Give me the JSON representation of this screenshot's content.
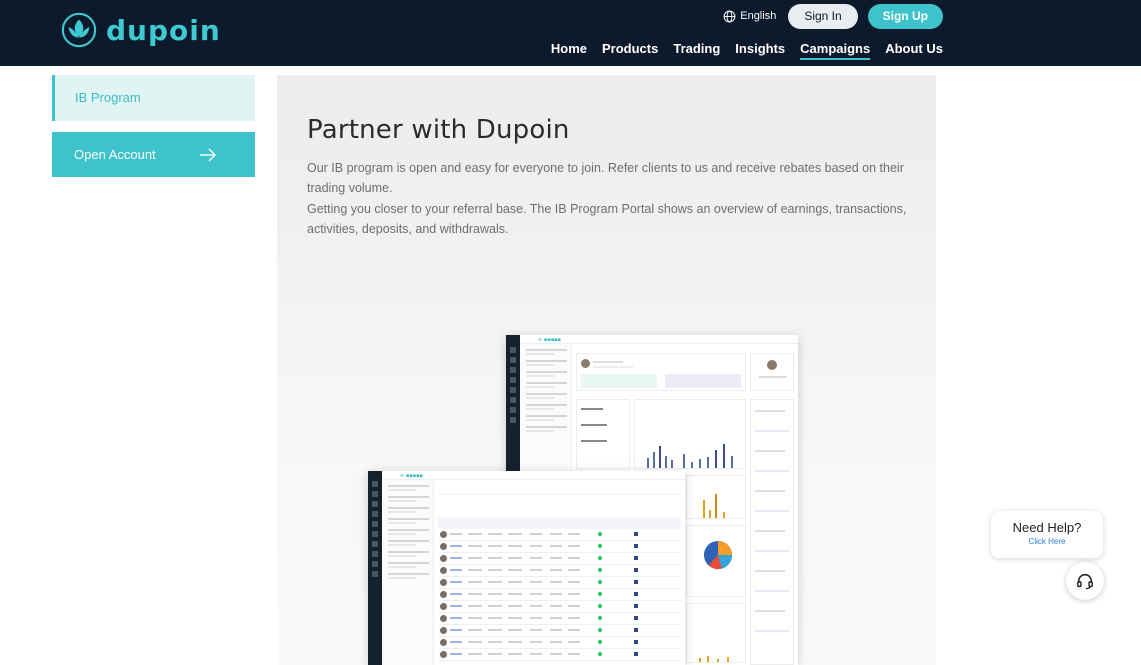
{
  "header": {
    "logo_text": "dupoin",
    "language": "English",
    "sign_in": "Sign In",
    "sign_up": "Sign Up",
    "nav": [
      {
        "label": "Home",
        "active": false
      },
      {
        "label": "Products",
        "active": false
      },
      {
        "label": "Trading",
        "active": false
      },
      {
        "label": "Insights",
        "active": false
      },
      {
        "label": "Campaigns",
        "active": true
      },
      {
        "label": "About Us",
        "active": false
      }
    ]
  },
  "sidebar": {
    "ib_program": "IB Program",
    "open_account": "Open Account"
  },
  "main": {
    "title": "Partner with Dupoin",
    "paragraph1": "Our IB program is open and easy for everyone to join. Refer clients to us and receive rebates based on their trading volume.",
    "paragraph2": "Getting you closer to your referral base. The IB Program Portal shows an overview of earnings, transactions, activities, deposits, and withdrawals."
  },
  "help": {
    "title": "Need Help?",
    "link": "Click Here"
  },
  "colors": {
    "header_bg": "#0c1a2c",
    "accent": "#3ec3cc",
    "sidebar_active_bg": "#e0f4f4"
  }
}
